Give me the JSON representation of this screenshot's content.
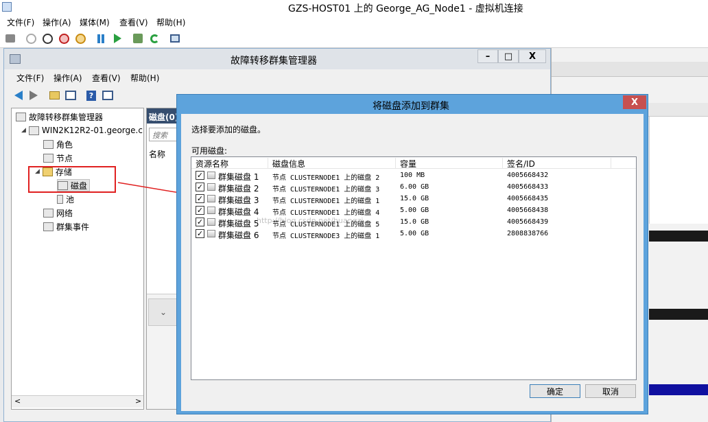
{
  "host": {
    "title": "GZS-HOST01 上的 George_AG_Node1 - 虚拟机连接",
    "menu": [
      "文件(F)",
      "操作(A)",
      "媒体(M)",
      "查看(V)",
      "帮助(H)"
    ]
  },
  "mmc": {
    "title": "故障转移群集管理器",
    "menu": [
      "文件(F)",
      "操作(A)",
      "查看(V)",
      "帮助(H)"
    ],
    "min_btn": "–",
    "max_btn": "□",
    "close_btn": "X"
  },
  "tree": {
    "root": "故障转移群集管理器",
    "cluster": "WIN2K12R2-01.george.c",
    "items": [
      {
        "label": "角色"
      },
      {
        "label": "节点"
      },
      {
        "label": "存储"
      },
      {
        "label": "磁盘"
      },
      {
        "label": "池"
      },
      {
        "label": "网络"
      },
      {
        "label": "群集事件"
      }
    ],
    "expander_open": "◢",
    "scroll_left": "<",
    "scroll_right": ">"
  },
  "middle": {
    "header": "磁盘(0)",
    "search_placeholder": "搜索",
    "column": "名称",
    "chevron": "⌄"
  },
  "dialog": {
    "title": "将磁盘添加到群集",
    "close": "X",
    "instruction": "选择要添加的磁盘。",
    "available_label": "可用磁盘:",
    "columns": [
      "资源名称",
      "磁盘信息",
      "容量",
      "签名/ID"
    ],
    "rows": [
      {
        "name": "群集磁盘 1",
        "info": "节点 CLUSTERNODE1 上的磁盘 2",
        "capacity": "100 MB",
        "sig": "4005668432",
        "checked": true
      },
      {
        "name": "群集磁盘 2",
        "info": "节点 CLUSTERNODE1 上的磁盘 3",
        "capacity": "6.00 GB",
        "sig": "4005668433",
        "checked": true
      },
      {
        "name": "群集磁盘 3",
        "info": "节点 CLUSTERNODE1 上的磁盘 1",
        "capacity": "15.0 GB",
        "sig": "4005668435",
        "checked": true
      },
      {
        "name": "群集磁盘 4",
        "info": "节点 CLUSTERNODE1 上的磁盘 4",
        "capacity": "5.00 GB",
        "sig": "4005668438",
        "checked": true
      },
      {
        "name": "群集磁盘 5",
        "info": "节点 CLUSTERNODE1 上的磁盘 5",
        "capacity": "15.0 GB",
        "sig": "4005668439",
        "checked": true
      },
      {
        "name": "群集磁盘 6",
        "info": "节点 CLUSTERNODE3 上的磁盘 1",
        "capacity": "5.00 GB",
        "sig": "2808838766",
        "checked": true
      }
    ],
    "watermark": "http://blog.csdn.net/huangzj",
    "ok": "确定",
    "cancel": "取消",
    "check_mark": "✓"
  },
  "colors": {
    "dialog_frame": "#5da3dc",
    "close_red": "#c75050",
    "highlight_red": "#e02020",
    "header_navy": "#364e6f"
  }
}
